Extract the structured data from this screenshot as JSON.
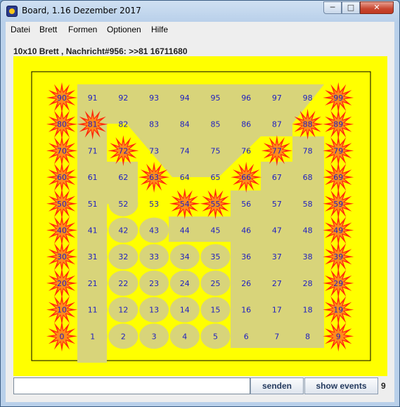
{
  "window": {
    "title": "Board, 1.16 Dezember 2017",
    "minimize": "─",
    "maximize": "□",
    "close": "✕",
    "icon": "board-app-icon"
  },
  "menu": [
    "Datei",
    "Brett",
    "Formen",
    "Optionen",
    "Hilfe"
  ],
  "status": "10x10 Brett , Nachricht#956: >>81 16711680",
  "colors": {
    "board": "#ffff00",
    "tile": "#d8d47a",
    "star_outer": "#ff2a0a",
    "star_inner": "#ff8a1c",
    "number": "#2020c0"
  },
  "board": {
    "size": 10,
    "numbers": [
      [
        90,
        91,
        92,
        93,
        94,
        95,
        96,
        97,
        98,
        99
      ],
      [
        80,
        81,
        82,
        83,
        84,
        85,
        86,
        87,
        88,
        89
      ],
      [
        70,
        71,
        72,
        73,
        74,
        75,
        76,
        77,
        78,
        79
      ],
      [
        60,
        61,
        62,
        63,
        64,
        65,
        66,
        67,
        68,
        69
      ],
      [
        50,
        51,
        52,
        53,
        54,
        55,
        56,
        57,
        58,
        59
      ],
      [
        40,
        41,
        42,
        43,
        44,
        45,
        46,
        47,
        48,
        49
      ],
      [
        30,
        31,
        32,
        33,
        34,
        35,
        36,
        37,
        38,
        39
      ],
      [
        20,
        21,
        22,
        23,
        24,
        25,
        26,
        27,
        28,
        29
      ],
      [
        10,
        11,
        12,
        13,
        14,
        15,
        16,
        17,
        18,
        19
      ],
      [
        0,
        1,
        2,
        3,
        4,
        5,
        6,
        7,
        8,
        9
      ]
    ],
    "stars": [
      90,
      99,
      80,
      81,
      88,
      89,
      70,
      72,
      77,
      79,
      60,
      63,
      66,
      69,
      50,
      54,
      55,
      59,
      40,
      49,
      30,
      39,
      20,
      29,
      10,
      19,
      0,
      9
    ],
    "circles": [
      61,
      51,
      52,
      41,
      42,
      43,
      31,
      32,
      33,
      34,
      35,
      21,
      22,
      23,
      24,
      25,
      11,
      12,
      13,
      14,
      15,
      1,
      2,
      3,
      4,
      5
    ]
  },
  "input": {
    "value": ""
  },
  "buttons": {
    "send": "senden",
    "events": "show events"
  },
  "counter": "9"
}
